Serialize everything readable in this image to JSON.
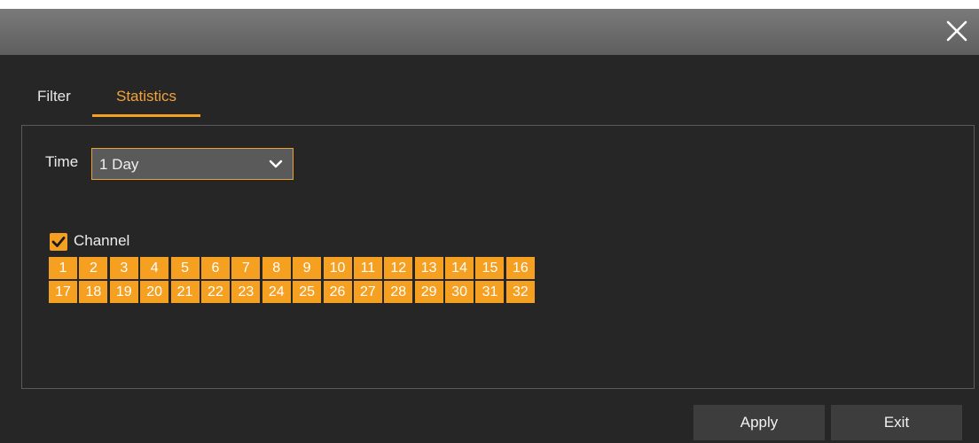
{
  "window": {
    "close_icon": "close-icon"
  },
  "tabs": [
    {
      "label": "Filter",
      "active": false
    },
    {
      "label": "Statistics",
      "active": true
    }
  ],
  "accent_color": "#f5a020",
  "time": {
    "label": "Time",
    "selected": "1 Day",
    "dropdown_icon": "chevron-down-icon"
  },
  "channel": {
    "label": "Channel",
    "checked": true,
    "rows": [
      [
        "1",
        "2",
        "3",
        "4",
        "5",
        "6",
        "7",
        "8",
        "9",
        "10",
        "11",
        "12",
        "13",
        "14",
        "15",
        "16"
      ],
      [
        "17",
        "18",
        "19",
        "20",
        "21",
        "22",
        "23",
        "24",
        "25",
        "26",
        "27",
        "28",
        "29",
        "30",
        "31",
        "32"
      ]
    ]
  },
  "buttons": {
    "apply": "Apply",
    "exit": "Exit"
  }
}
